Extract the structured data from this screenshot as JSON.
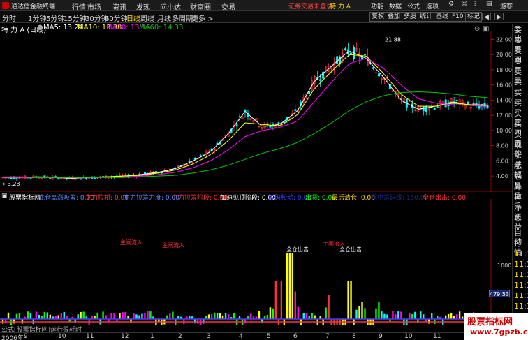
{
  "titlebar": {
    "app_title": "通达信金融终端",
    "menus": [
      "行情",
      "市场",
      "资讯",
      "发现",
      "问小达",
      "财富圈",
      "交易"
    ],
    "notice": "证券交易未登录",
    "notice_stock": "特 力 A",
    "right_menus": [
      "功能",
      "数据",
      "公式",
      "选项"
    ],
    "guest": "游客"
  },
  "toolbar": {
    "periods": [
      "分时",
      "1分钟",
      "5分钟",
      "15分钟",
      "30分钟",
      "60分钟",
      "日线",
      "周线",
      "月线",
      "多周期",
      "更多 >"
    ],
    "active_period": "日线",
    "right_buttons": [
      "复权",
      "叠加",
      "多股",
      "统计",
      "画线",
      "F10",
      "标记"
    ]
  },
  "chart_header": {
    "stock": "特 力 A (日线)",
    "ma5": "MA5: 13.24",
    "ma10": "MA10: 13.38",
    "ma20": "MA20: 13.16",
    "ma60": "MA60: 14.33"
  },
  "colors": {
    "up": "#ff3232",
    "down": "#00ffff",
    "ma5": "#ffffff",
    "ma10": "#ffff00",
    "ma20": "#ff00ff",
    "ma60": "#00c800"
  },
  "price_axis": {
    "ticks": [
      "22.00",
      "20.00",
      "18.00",
      "16.00",
      "14.00",
      "12.00",
      "10.00",
      "8.00",
      "6.00",
      "4.00"
    ],
    "high_label": "21.88",
    "low_label": "3.28"
  },
  "chart_data": [
    {
      "type": "line",
      "title": "",
      "xlabel": "",
      "ylabel": "",
      "ylim": [
        3.0,
        22.5
      ],
      "series": [
        {
          "name": "MA5",
          "values": [
            3.8,
            3.8,
            3.9,
            3.8,
            3.7,
            3.8,
            3.9,
            4.0,
            4.2,
            4.5,
            5.0,
            6.0,
            7.2,
            9.5,
            12.5,
            10.5,
            10.8,
            12.5,
            16.5,
            18.5,
            20.5,
            19.5,
            17.0,
            14.0,
            12.8,
            13.2,
            13.8,
            13.3,
            13.2
          ]
        },
        {
          "name": "MA10",
          "values": [
            3.8,
            3.8,
            3.8,
            3.8,
            3.8,
            3.8,
            3.9,
            4.0,
            4.1,
            4.4,
            4.8,
            5.6,
            6.8,
            8.6,
            11.0,
            10.8,
            10.6,
            12.0,
            15.5,
            17.8,
            20.0,
            19.8,
            17.5,
            14.8,
            13.2,
            13.2,
            13.6,
            13.4,
            13.38
          ]
        },
        {
          "name": "MA20",
          "values": [
            3.8,
            3.8,
            3.8,
            3.8,
            3.8,
            3.8,
            3.8,
            3.9,
            4.0,
            4.2,
            4.5,
            5.1,
            6.0,
            7.4,
            9.2,
            10.0,
            10.4,
            11.2,
            13.8,
            16.4,
            18.8,
            19.5,
            18.2,
            16.0,
            14.2,
            13.6,
            13.4,
            13.3,
            13.16
          ]
        },
        {
          "name": "MA60",
          "values": [
            3.9,
            3.9,
            3.8,
            3.8,
            3.8,
            3.8,
            3.8,
            3.8,
            3.9,
            4.0,
            4.1,
            4.4,
            4.8,
            5.4,
            6.2,
            7.0,
            7.6,
            8.4,
            9.6,
            11.0,
            12.6,
            13.8,
            14.6,
            15.0,
            15.1,
            15.0,
            14.8,
            14.5,
            14.33
          ]
        }
      ]
    },
    {
      "type": "bar",
      "title": "",
      "ylim": [
        -10,
        1200
      ],
      "annotations": [
        "主闸流入",
        "主闸流入",
        "主闸流入",
        "全仓出击",
        "全仓出击"
      ],
      "scale_ticks": [
        "1000",
        "500"
      ],
      "cursor_value": "479.53"
    }
  ],
  "indicator_header": {
    "name": "股票指标网",
    "items": [
      {
        "label": "底仓高涨吸筹: 0.00",
        "color": "#5b8cff"
      },
      {
        "label": "主力拉桥: 0.00",
        "color": "#ff4040"
      },
      {
        "label": "主力拉筹力度: 0.00",
        "color": "#5b8cff"
      },
      {
        "label": "主力拉筹阶段: 0.00",
        "color": "#ff3232"
      },
      {
        "label": "加速见顶阶段: 0.00",
        "color": "#ffffff"
      },
      {
        "label": "筹码松动: 0.00",
        "color": "#4040ff"
      },
      {
        "label": "出货: 0.00",
        "color": "#00ff00"
      },
      {
        "label": "最后清仓: 0.00",
        "color": "#ffd700"
      },
      {
        "label": "超中筹码线: 150.00",
        "color": "#1a2a8a"
      },
      {
        "label": "全仓出击: 0.00",
        "color": "#ff3232"
      }
    ]
  },
  "side_panel": {
    "labels": [
      "委比",
      "卖五",
      "卖四",
      "卖三",
      "卖二",
      "卖一",
      "买一",
      "买二",
      "买三",
      "买四",
      "买五",
      "现价",
      "涨跌",
      "涨幅",
      "总量",
      "外盘",
      "换手",
      "净资",
      "收益",
      "自动",
      "行情",
      "11:1",
      "11:1",
      "11:1",
      "11:1",
      "11:1",
      "11:1",
      "11:1"
    ]
  },
  "footer": {
    "formula_text": "公式[股票指标网]运行很耗时",
    "dates": [
      "2006年",
      "9",
      "10",
      "11",
      "12",
      "1",
      "2",
      "3",
      "4",
      "5",
      "6",
      "7",
      "8",
      "9",
      "10",
      "11"
    ]
  },
  "watermark": {
    "top": "股票指标网",
    "bottom": "www.7gpzb.com"
  }
}
